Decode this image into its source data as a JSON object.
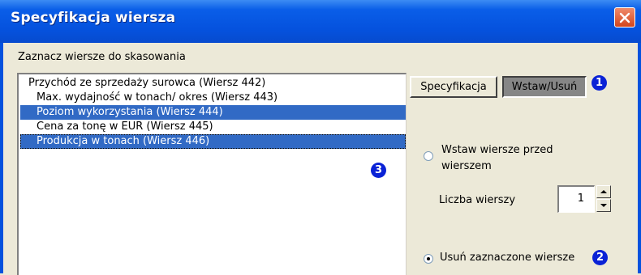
{
  "window": {
    "title": "Specyfikacja wiersza"
  },
  "caption": "Zaznacz wiersze do skasowania",
  "list": {
    "items": [
      {
        "label": "Przychód ze sprzedaży surowca (Wiersz 442)",
        "selected": false
      },
      {
        "label": "Max. wydajność w tonach/ okres (Wiersz 443)",
        "selected": false
      },
      {
        "label": "Poziom wykorzystania (Wiersz 444)",
        "selected": true
      },
      {
        "label": "Cena za tonę w EUR (Wiersz 445)",
        "selected": false
      },
      {
        "label": "Produkcja w tonach (Wiersz 446)",
        "selected": true
      }
    ]
  },
  "buttons": {
    "spec": "Specyfikacja",
    "insert_delete": "Wstaw/Usuń"
  },
  "badges": {
    "b1": "1",
    "b2": "2",
    "b3": "3"
  },
  "insert_option": {
    "line1": "Wstaw wiersze przed",
    "line2": "wierszem",
    "checked": false
  },
  "row_count": {
    "label": "Liczba wierszy",
    "value": "1"
  },
  "delete_option": {
    "label": "Usuń zaznaczone wiersze",
    "checked": true
  },
  "colors": {
    "title_bar": "#0552de",
    "selection": "#316ac5",
    "badge": "#0a22d6",
    "close": "#d2451c"
  }
}
